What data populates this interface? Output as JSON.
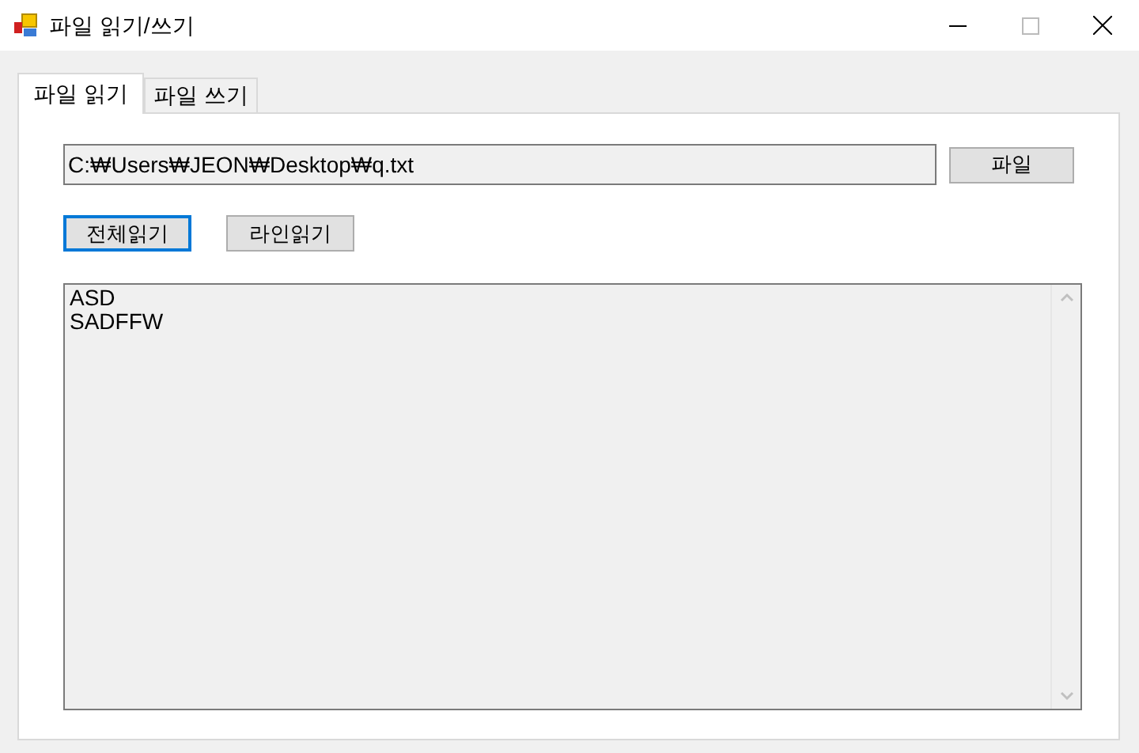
{
  "window": {
    "title": "파일 읽기/쓰기"
  },
  "tabs": [
    {
      "label": "파일 읽기",
      "selected": true
    },
    {
      "label": "파일 쓰기",
      "selected": false
    }
  ],
  "path_field": {
    "value": "C:₩Users₩JEON₩Desktop₩q.txt"
  },
  "file_button": {
    "label": "파일"
  },
  "buttons": [
    {
      "label": "전체읽기",
      "focused": true
    },
    {
      "label": "라인읽기",
      "focused": false
    }
  ],
  "text_area": {
    "lines": [
      "ASD",
      "SADFFW"
    ]
  }
}
